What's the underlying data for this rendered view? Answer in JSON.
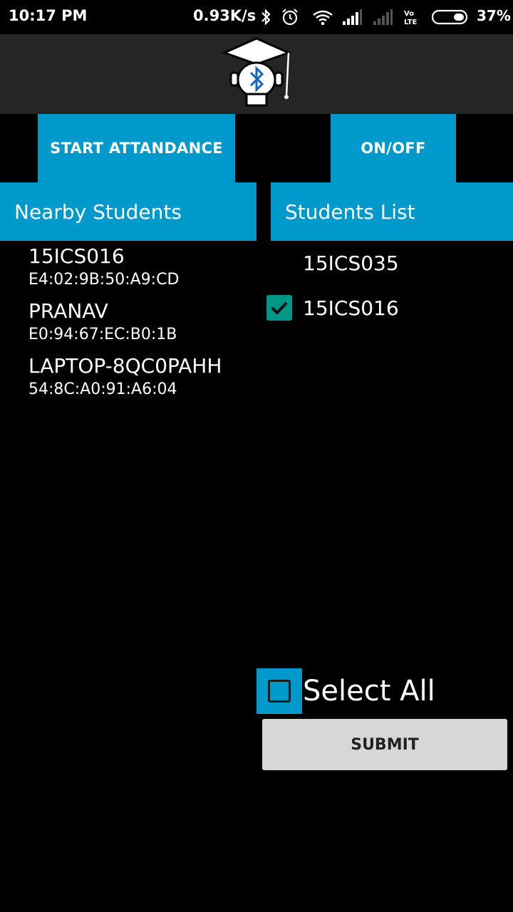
{
  "status_bar": {
    "time": "10:17 PM",
    "net_speed": "0.93K/s",
    "battery": "37%",
    "icons": [
      "bluetooth-icon",
      "alarm-icon",
      "wifi-icon",
      "signal-icon",
      "signal-weak-icon",
      "volte-icon",
      "battery-icon"
    ]
  },
  "app_bar": {
    "logo": "graduation-cap-bluetooth-logo"
  },
  "buttons": {
    "start_attendance": "START ATTANDANCE",
    "on_off": "ON/OFF",
    "submit": "SUBMIT"
  },
  "nearby": {
    "header": "Nearby Students",
    "devices": [
      {
        "name": "15ICS016",
        "mac": "E4:02:9B:50:A9:CD"
      },
      {
        "name": "PRANAV",
        "mac": "E0:94:67:EC:B0:1B"
      },
      {
        "name": "LAPTOP-8QC0PAHH",
        "mac": "54:8C:A0:91:A6:04"
      }
    ]
  },
  "students": {
    "header": "Students List",
    "items": [
      {
        "label": "15ICS035",
        "checked": false
      },
      {
        "label": "15ICS016",
        "checked": true
      }
    ]
  },
  "select_all": {
    "label": "Select All",
    "checked": false
  },
  "colors": {
    "accent": "#0099cc",
    "check": "#009688",
    "app_bar": "#252525",
    "submit_bg": "#d6d7d7"
  }
}
